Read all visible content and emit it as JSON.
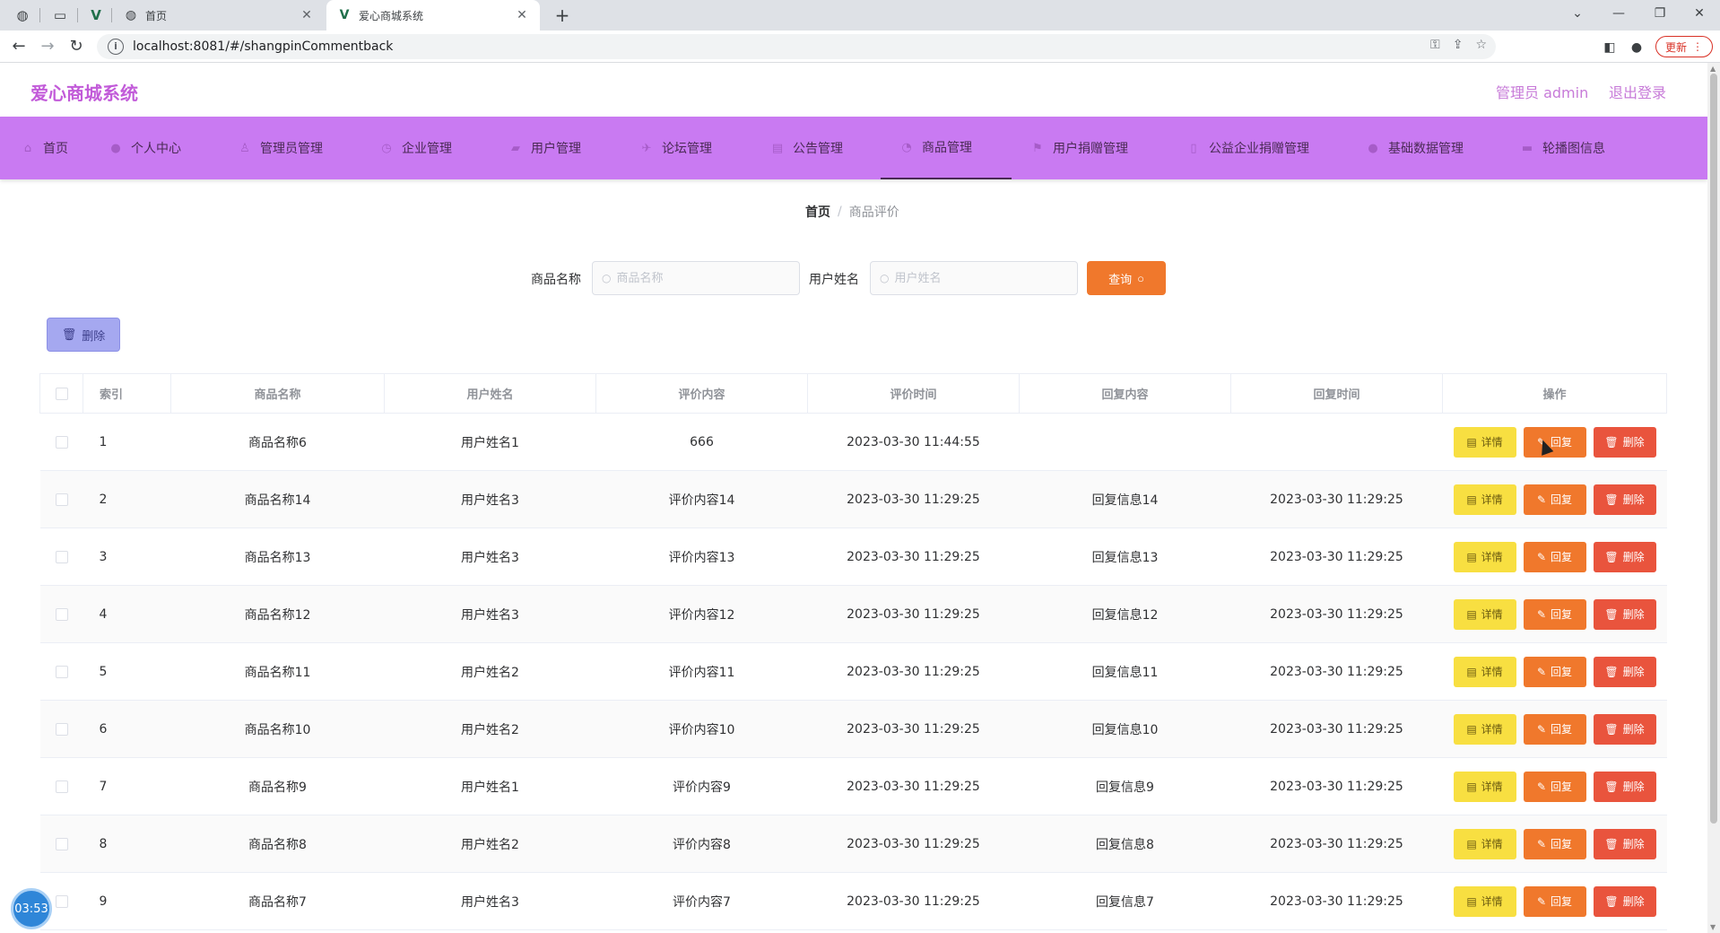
{
  "browser": {
    "tabs": [
      {
        "title": "首页",
        "close": "✕"
      },
      {
        "title": "爱心商城系统",
        "close": "✕"
      }
    ],
    "new_tab": "+",
    "url": "localhost:8081/#/shangpinCommentback",
    "update_label": "更新"
  },
  "header": {
    "app_title": "爱心商城系统",
    "admin_label": "管理员 admin",
    "logout_label": "退出登录"
  },
  "nav": {
    "items": [
      {
        "label": "首页",
        "icon": "home-icon"
      },
      {
        "label": "个人中心",
        "icon": "user-icon"
      },
      {
        "label": "管理员管理",
        "icon": "admin-icon"
      },
      {
        "label": "企业管理",
        "icon": "enterprise-icon"
      },
      {
        "label": "用户管理",
        "icon": "users-icon"
      },
      {
        "label": "论坛管理",
        "icon": "forum-icon"
      },
      {
        "label": "公告管理",
        "icon": "notice-icon"
      },
      {
        "label": "商品管理",
        "icon": "goods-icon"
      },
      {
        "label": "用户捐赠管理",
        "icon": "flag-icon"
      },
      {
        "label": "公益企业捐赠管理",
        "icon": "charity-icon"
      },
      {
        "label": "基础数据管理",
        "icon": "data-icon"
      },
      {
        "label": "轮播图信息",
        "icon": "carousel-icon"
      }
    ],
    "active_index": 7
  },
  "breadcrumb": {
    "home": "首页",
    "separator": "/",
    "current": "商品评价"
  },
  "search": {
    "product_label": "商品名称",
    "product_placeholder": "商品名称",
    "product_value": "",
    "user_label": "用户姓名",
    "user_placeholder": "用户姓名",
    "user_value": "",
    "query_label": "查询"
  },
  "bulk_delete_label": "删除",
  "table": {
    "columns": [
      "索引",
      "商品名称",
      "用户姓名",
      "评价内容",
      "评价时间",
      "回复内容",
      "回复时间",
      "操作"
    ],
    "rows": [
      {
        "index": "1",
        "product": "商品名称6",
        "user": "用户姓名1",
        "content": "666",
        "time": "2023-03-30 11:44:55",
        "reply": "",
        "reply_time": ""
      },
      {
        "index": "2",
        "product": "商品名称14",
        "user": "用户姓名3",
        "content": "评价内容14",
        "time": "2023-03-30 11:29:25",
        "reply": "回复信息14",
        "reply_time": "2023-03-30 11:29:25"
      },
      {
        "index": "3",
        "product": "商品名称13",
        "user": "用户姓名3",
        "content": "评价内容13",
        "time": "2023-03-30 11:29:25",
        "reply": "回复信息13",
        "reply_time": "2023-03-30 11:29:25"
      },
      {
        "index": "4",
        "product": "商品名称12",
        "user": "用户姓名3",
        "content": "评价内容12",
        "time": "2023-03-30 11:29:25",
        "reply": "回复信息12",
        "reply_time": "2023-03-30 11:29:25"
      },
      {
        "index": "5",
        "product": "商品名称11",
        "user": "用户姓名2",
        "content": "评价内容11",
        "time": "2023-03-30 11:29:25",
        "reply": "回复信息11",
        "reply_time": "2023-03-30 11:29:25"
      },
      {
        "index": "6",
        "product": "商品名称10",
        "user": "用户姓名2",
        "content": "评价内容10",
        "time": "2023-03-30 11:29:25",
        "reply": "回复信息10",
        "reply_time": "2023-03-30 11:29:25"
      },
      {
        "index": "7",
        "product": "商品名称9",
        "user": "用户姓名1",
        "content": "评价内容9",
        "time": "2023-03-30 11:29:25",
        "reply": "回复信息9",
        "reply_time": "2023-03-30 11:29:25"
      },
      {
        "index": "8",
        "product": "商品名称8",
        "user": "用户姓名2",
        "content": "评价内容8",
        "time": "2023-03-30 11:29:25",
        "reply": "回复信息8",
        "reply_time": "2023-03-30 11:29:25"
      },
      {
        "index": "9",
        "product": "商品名称7",
        "user": "用户姓名3",
        "content": "评价内容7",
        "time": "2023-03-30 11:29:25",
        "reply": "回复信息7",
        "reply_time": "2023-03-30 11:29:25"
      }
    ],
    "actions": {
      "detail": "详情",
      "reply": "回复",
      "delete": "删除"
    }
  },
  "timer": "03:53",
  "colors": {
    "nav_bg": "#c97af2",
    "title": "#c25bd9",
    "query_btn": "#f0782c",
    "detail_btn": "#f8df41",
    "reply_btn": "#f0782c",
    "delete_btn": "#e9543d",
    "bulk_delete_btn": "#a5a8f0"
  }
}
